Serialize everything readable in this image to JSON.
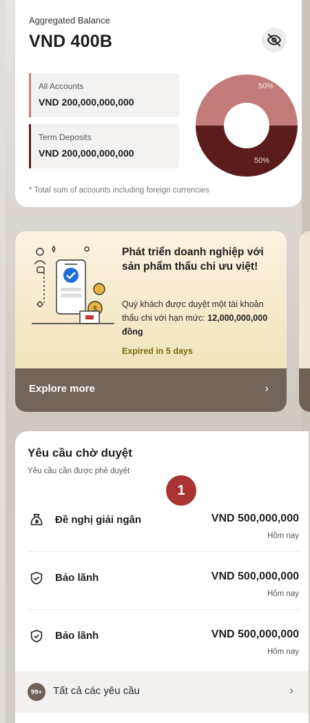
{
  "balance": {
    "label": "Aggregated Balance",
    "amount": "VND 400B",
    "hide_icon": "eye-slash-icon",
    "accounts": [
      {
        "label": "All Accounts",
        "value": "VND 200,000,000,000",
        "percent": 50,
        "color": "#c27b79"
      },
      {
        "label": "Term Deposits",
        "value": "VND 200,000,000,000",
        "percent": 50,
        "color": "#5d1c1c"
      }
    ],
    "chart_labels": [
      "50%",
      "50%"
    ],
    "note": "* Total sum of accounts including foreign currencies"
  },
  "promo": {
    "title": "Phát triển doanh nghiệp với sản phẩm thấu chi ưu việt!",
    "desc_prefix": "Quý khách được duyệt một tài khoản thấu chi với hạn mức: ",
    "desc_amount": "12,000,000,000 đồng",
    "expire": "Expired in 5 days",
    "explore_label": "Explore more",
    "chevron": "›",
    "illustration": "phone-approval-illustration"
  },
  "requests": {
    "title": "Yêu cầu chờ duyệt",
    "subtitle": "Yêu cầu cần được phê duyệt",
    "marker": "1",
    "items": [
      {
        "icon": "money-bag-icon",
        "name": "Đề nghị giải ngân",
        "amount": "VND 500,000,000",
        "date": "Hôm nay"
      },
      {
        "icon": "shield-check-icon",
        "name": "Bảo lãnh",
        "amount": "VND 500,000,000",
        "date": "Hôm nay"
      },
      {
        "icon": "shield-check-icon",
        "name": "Bảo lãnh",
        "amount": "VND 500,000,000",
        "date": "Hôm nay"
      }
    ],
    "footer": {
      "count": "99+",
      "label": "Tất cả các yêu cầu",
      "chevron": "›"
    }
  },
  "colors": {
    "brand_dark": "#5d1c1c",
    "brand_light": "#c27b79",
    "badge": "#a93232",
    "expire_text": "#7c6a12"
  }
}
